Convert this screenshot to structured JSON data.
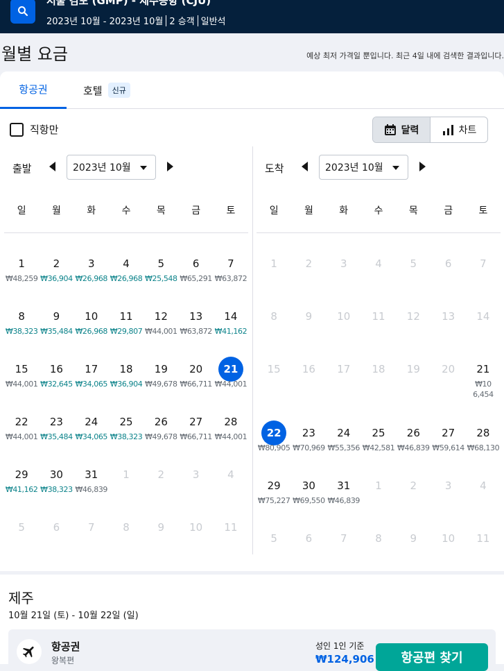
{
  "header": {
    "route": "서울 김포 (GMP) - 제주공항 (CJU)",
    "dates": "2023년 10월 - 2023년 10월",
    "passengers": "2 승객",
    "cabin": "일반석"
  },
  "page_title": "월별 요금",
  "notice": "예상 최저 가격일 뿐입니다. 최근 4일 내에 검색한 결과입니다.",
  "tabs": {
    "flights": "항공권",
    "hotels": "호텔",
    "hotels_badge": "신규"
  },
  "direct_only": "직항만",
  "view_toggle": {
    "calendar": "달력",
    "chart": "차트"
  },
  "weekdays": [
    "일",
    "월",
    "화",
    "수",
    "목",
    "금",
    "토"
  ],
  "depart": {
    "label": "출발",
    "month": "2023년 10월",
    "days": [
      {
        "d": "1",
        "p": "₩48,259",
        "low": false
      },
      {
        "d": "2",
        "p": "₩36,904",
        "low": true
      },
      {
        "d": "3",
        "p": "₩26,968",
        "low": true
      },
      {
        "d": "4",
        "p": "₩26,968",
        "low": true
      },
      {
        "d": "5",
        "p": "₩25,548",
        "low": true
      },
      {
        "d": "6",
        "p": "₩65,291",
        "low": false
      },
      {
        "d": "7",
        "p": "₩63,872",
        "low": false
      },
      {
        "d": "8",
        "p": "₩38,323",
        "low": true
      },
      {
        "d": "9",
        "p": "₩35,484",
        "low": true
      },
      {
        "d": "10",
        "p": "₩26,968",
        "low": true
      },
      {
        "d": "11",
        "p": "₩29,807",
        "low": true
      },
      {
        "d": "12",
        "p": "₩44,001",
        "low": false
      },
      {
        "d": "13",
        "p": "₩63,872",
        "low": false
      },
      {
        "d": "14",
        "p": "₩41,162",
        "low": true
      },
      {
        "d": "15",
        "p": "₩44,001",
        "low": false
      },
      {
        "d": "16",
        "p": "₩32,645",
        "low": true
      },
      {
        "d": "17",
        "p": "₩34,065",
        "low": true
      },
      {
        "d": "18",
        "p": "₩36,904",
        "low": true
      },
      {
        "d": "19",
        "p": "₩49,678",
        "low": false
      },
      {
        "d": "20",
        "p": "₩66,711",
        "low": false
      },
      {
        "d": "21",
        "p": "₩44,001",
        "low": false,
        "sel": true
      },
      {
        "d": "22",
        "p": "₩44,001",
        "low": false
      },
      {
        "d": "23",
        "p": "₩35,484",
        "low": true
      },
      {
        "d": "24",
        "p": "₩34,065",
        "low": true
      },
      {
        "d": "25",
        "p": "₩38,323",
        "low": true
      },
      {
        "d": "26",
        "p": "₩49,678",
        "low": false
      },
      {
        "d": "27",
        "p": "₩66,711",
        "low": false
      },
      {
        "d": "28",
        "p": "₩44,001",
        "low": false
      },
      {
        "d": "29",
        "p": "₩41,162",
        "low": true
      },
      {
        "d": "30",
        "p": "₩38,323",
        "low": true
      },
      {
        "d": "31",
        "p": "₩46,839",
        "low": false
      },
      {
        "d": "1",
        "dim": true
      },
      {
        "d": "2",
        "dim": true
      },
      {
        "d": "3",
        "dim": true
      },
      {
        "d": "4",
        "dim": true
      },
      {
        "d": "5",
        "dim": true
      },
      {
        "d": "6",
        "dim": true
      },
      {
        "d": "7",
        "dim": true
      },
      {
        "d": "8",
        "dim": true
      },
      {
        "d": "9",
        "dim": true
      },
      {
        "d": "10",
        "dim": true
      },
      {
        "d": "11",
        "dim": true
      }
    ]
  },
  "return": {
    "label": "도착",
    "month": "2023년 10월",
    "days": [
      {
        "d": "1",
        "dim": true
      },
      {
        "d": "2",
        "dim": true
      },
      {
        "d": "3",
        "dim": true
      },
      {
        "d": "4",
        "dim": true
      },
      {
        "d": "5",
        "dim": true
      },
      {
        "d": "6",
        "dim": true
      },
      {
        "d": "7",
        "dim": true
      },
      {
        "d": "8",
        "dim": true
      },
      {
        "d": "9",
        "dim": true
      },
      {
        "d": "10",
        "dim": true
      },
      {
        "d": "11",
        "dim": true
      },
      {
        "d": "12",
        "dim": true
      },
      {
        "d": "13",
        "dim": true
      },
      {
        "d": "14",
        "dim": true
      },
      {
        "d": "15",
        "dim": true
      },
      {
        "d": "16",
        "dim": true
      },
      {
        "d": "17",
        "dim": true
      },
      {
        "d": "18",
        "dim": true
      },
      {
        "d": "19",
        "dim": true
      },
      {
        "d": "20",
        "dim": true
      },
      {
        "d": "21",
        "p": "₩106,454",
        "low": false
      },
      {
        "d": "22",
        "p": "₩80,905",
        "low": false,
        "sel": true
      },
      {
        "d": "23",
        "p": "₩70,969",
        "low": false
      },
      {
        "d": "24",
        "p": "₩55,356",
        "low": false
      },
      {
        "d": "25",
        "p": "₩42,581",
        "low": false
      },
      {
        "d": "26",
        "p": "₩46,839",
        "low": false
      },
      {
        "d": "27",
        "p": "₩59,614",
        "low": false
      },
      {
        "d": "28",
        "p": "₩68,130",
        "low": false
      },
      {
        "d": "29",
        "p": "₩75,227",
        "low": false
      },
      {
        "d": "30",
        "p": "₩69,550",
        "low": false
      },
      {
        "d": "31",
        "p": "₩46,839",
        "low": false
      },
      {
        "d": "1",
        "dim": true
      },
      {
        "d": "2",
        "dim": true
      },
      {
        "d": "3",
        "dim": true
      },
      {
        "d": "4",
        "dim": true
      },
      {
        "d": "5",
        "dim": true
      },
      {
        "d": "6",
        "dim": true
      },
      {
        "d": "7",
        "dim": true
      },
      {
        "d": "8",
        "dim": true
      },
      {
        "d": "9",
        "dim": true
      },
      {
        "d": "10",
        "dim": true
      },
      {
        "d": "11",
        "dim": true
      }
    ]
  },
  "summary": {
    "destination": "제주",
    "dates": "10월 21일 (토) - 10월 22일 (일)",
    "product": "항공권",
    "trip_type": "왕복편",
    "basis": "성인 1인 기준",
    "price": "₩124,906",
    "cta": "항공편 찾기"
  },
  "colors": {
    "brand": "#0062e3",
    "navy": "#05203c",
    "low_price": "#0c838a",
    "cta": "#00a698"
  }
}
